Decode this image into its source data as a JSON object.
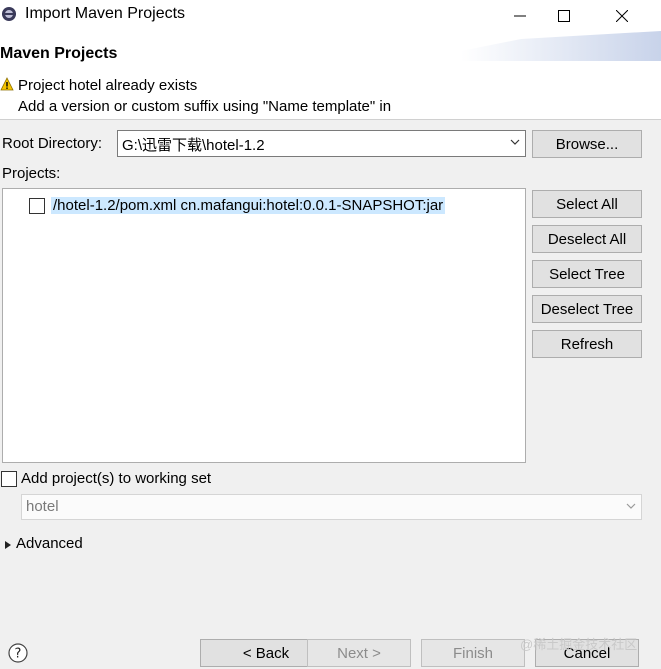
{
  "window": {
    "title": "Import Maven Projects"
  },
  "header": {
    "title": "Maven Projects",
    "message_line1": "Project hotel already exists",
    "message_line2": "Add a version or custom suffix using \"Name template\" in"
  },
  "root_directory": {
    "label": "Root Directory:",
    "value": "G:\\迅雷下载\\hotel-1.2",
    "browse_label": "Browse..."
  },
  "projects": {
    "label": "Projects:",
    "items": [
      {
        "text": "/hotel-1.2/pom.xml  cn.mafangui:hotel:0.0.1-SNAPSHOT:jar",
        "checked": false
      }
    ]
  },
  "side_buttons": [
    "Select All",
    "Deselect All",
    "Select Tree",
    "Deselect Tree",
    "Refresh"
  ],
  "working_set": {
    "label": "Add project(s) to working set",
    "value": "hotel"
  },
  "advanced": {
    "label": "Advanced"
  },
  "footer": {
    "back": "< Back",
    "next": "Next >",
    "finish": "Finish",
    "cancel": "Cancel"
  },
  "watermark": "@稀土掘金技术社区"
}
